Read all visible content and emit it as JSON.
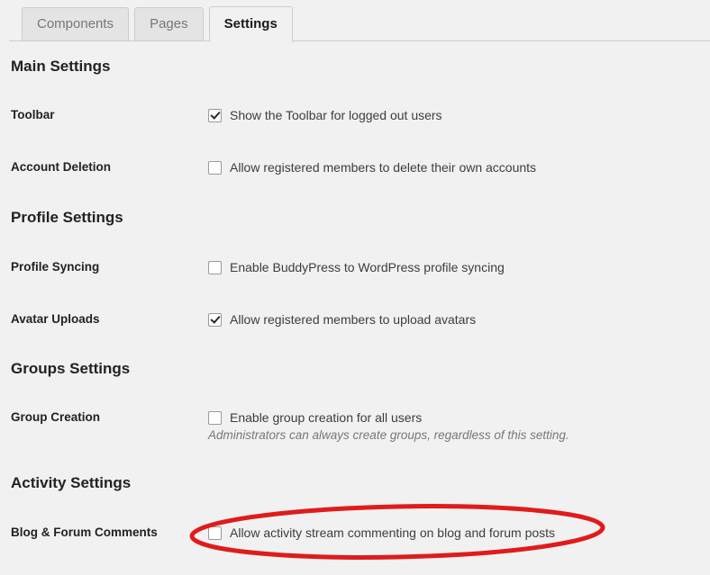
{
  "tabs": [
    {
      "label": "Components",
      "active": false
    },
    {
      "label": "Pages",
      "active": false
    },
    {
      "label": "Settings",
      "active": true
    }
  ],
  "sections": [
    {
      "title": "Main Settings",
      "rows": [
        {
          "label": "Toolbar",
          "checkbox_label": "Show the Toolbar for logged out users",
          "checked": true,
          "description": ""
        },
        {
          "label": "Account Deletion",
          "checkbox_label": "Allow registered members to delete their own accounts",
          "checked": false,
          "description": ""
        }
      ]
    },
    {
      "title": "Profile Settings",
      "rows": [
        {
          "label": "Profile Syncing",
          "checkbox_label": "Enable BuddyPress to WordPress profile syncing",
          "checked": false,
          "description": ""
        },
        {
          "label": "Avatar Uploads",
          "checkbox_label": "Allow registered members to upload avatars",
          "checked": true,
          "description": ""
        }
      ]
    },
    {
      "title": "Groups Settings",
      "rows": [
        {
          "label": "Group Creation",
          "checkbox_label": "Enable group creation for all users",
          "checked": false,
          "description": "Administrators can always create groups, regardless of this setting."
        }
      ]
    },
    {
      "title": "Activity Settings",
      "rows": [
        {
          "label": "Blog & Forum Comments",
          "checkbox_label": "Allow activity stream commenting on blog and forum posts",
          "checked": false,
          "description": ""
        }
      ]
    }
  ],
  "annotation": {
    "shape": "ellipse",
    "color": "#e01b1b",
    "target": "Allow activity stream commenting on blog and forum posts"
  },
  "colors": {
    "page_background": "#f1f1f1",
    "tab_inactive_background": "#e4e4e4",
    "tab_active_background": "#f1f1f1",
    "border": "#cccccc",
    "heading_text": "#222222",
    "body_text": "#3d3d3d",
    "muted_text": "#777777",
    "annotation_red": "#e01b1b"
  }
}
